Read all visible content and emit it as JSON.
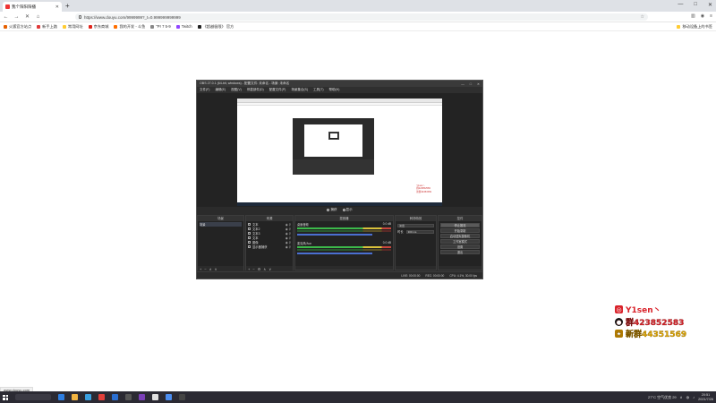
{
  "browser": {
    "tab_title": "我个阳阳阳播",
    "new_tab": "+",
    "window_controls": [
      "—",
      "□",
      "✕"
    ],
    "url": "https://www.douyu.com/9999999?_t=0.999999999999",
    "bookmarks": [
      {
        "label": "火狐官方站点",
        "color": "#e66000"
      },
      {
        "label": "新手上路",
        "color": "#e03a3a"
      },
      {
        "label": "常用网址",
        "color": "#ffcc33"
      },
      {
        "label": "京东商城",
        "color": "#e1251b"
      },
      {
        "label": "我的开发 - 斗鱼",
        "color": "#ff6f00"
      },
      {
        "label": "\"Pr 7 5-9",
        "color": "#888888"
      },
      {
        "label": "Twitch",
        "color": "#9146ff"
      },
      {
        "label": "《超越极限》 官方",
        "color": "#222222"
      }
    ],
    "bookmarks_right": "移动设备上的书签",
    "status_url": "www.douyu.com"
  },
  "obs": {
    "title": "OBS 27.0.1 (64-bit, windows) - 配置文件: 未命名 - 场景: 未命名",
    "window_controls": [
      "—",
      "□",
      "✕"
    ],
    "menu": [
      "文件(F)",
      "编辑(E)",
      "视图(V)",
      "停靠部件(D)",
      "配置文件(P)",
      "场景集合(S)",
      "工具(T)",
      "帮助(H)"
    ],
    "rec_bar": {
      "left": "捕获",
      "right": "显示"
    },
    "dock_titles": {
      "scenes": "场景",
      "sources": "来源",
      "mixer": "混音器",
      "transitions": "转场特效",
      "controls": "控件"
    },
    "scene": "场景",
    "sources": [
      "文本",
      "文本2",
      "文本3",
      "文本",
      "图像",
      "显示器捕获"
    ],
    "mixer": [
      {
        "name": "桌面音频",
        "db": "0.0 dB"
      },
      {
        "name": "麦克风/Aux",
        "db": "0.0 dB"
      }
    ],
    "transitions": {
      "type_label": "淡出",
      "duration_label": "时长",
      "duration_value": "300 ms"
    },
    "controls": [
      "停止推流",
      "开始录制",
      "启动虚拟摄像机",
      "工作室模式",
      "设置",
      "退出"
    ],
    "status": [
      "LIVE: 00:00:00",
      "REC: 00:00:00",
      "CPU: 4.1%, 30.00 fps"
    ]
  },
  "watermark": {
    "line1": "Y1sen丶",
    "line2": "群423852583",
    "line3": "新群44351569",
    "colors": {
      "line1": "#d9222a",
      "line2": "#d9222a",
      "line3": "#e0a800"
    }
  },
  "taskbar": {
    "apps": [
      "#2d7de0",
      "#f2b441",
      "#3aa0e0",
      "#e2403a",
      "#2b6fd1",
      "#555555",
      "#7a3fb6",
      "#e0e0e0",
      "#4b8df0",
      "#444444"
    ],
    "weather": "27°C 空气优良 29",
    "time": "20:51",
    "date": "2021/7/26"
  }
}
